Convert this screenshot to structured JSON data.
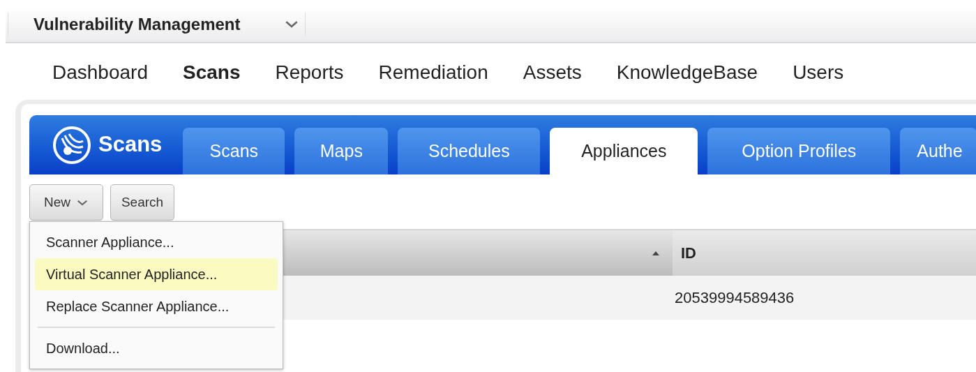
{
  "app_switcher": {
    "title": "Vulnerability Management"
  },
  "nav": [
    {
      "label": "Dashboard",
      "selected": false
    },
    {
      "label": "Scans",
      "selected": true
    },
    {
      "label": "Reports",
      "selected": false
    },
    {
      "label": "Remediation",
      "selected": false
    },
    {
      "label": "Assets",
      "selected": false
    },
    {
      "label": "KnowledgeBase",
      "selected": false
    },
    {
      "label": "Users",
      "selected": false
    }
  ],
  "module": {
    "title": "Scans"
  },
  "tabs": [
    {
      "label": "Scans",
      "selected": false
    },
    {
      "label": "Maps",
      "selected": false
    },
    {
      "label": "Schedules",
      "selected": false
    },
    {
      "label": "Appliances",
      "selected": true
    },
    {
      "label": "Option Profiles",
      "selected": false
    },
    {
      "label": "Authe",
      "selected": false
    }
  ],
  "toolbar": {
    "new_button": "New",
    "search_button": "Search"
  },
  "table": {
    "columns": [
      {
        "sort_ascending": true
      },
      {
        "label": "ID",
        "sort_ascending": false
      }
    ],
    "rows": [
      {
        "column_2": "20539994589436"
      }
    ]
  },
  "new_menu": {
    "items": [
      {
        "label": "Scanner Appliance...",
        "kind": "item",
        "highlighted": false
      },
      {
        "label": "Virtual Scanner Appliance...",
        "kind": "item",
        "highlighted": true
      },
      {
        "label": "Replace Scanner Appliance...",
        "kind": "item",
        "highlighted": false
      },
      {
        "kind": "separator"
      },
      {
        "label": "Download...",
        "kind": "item",
        "highlighted": false
      }
    ]
  }
}
